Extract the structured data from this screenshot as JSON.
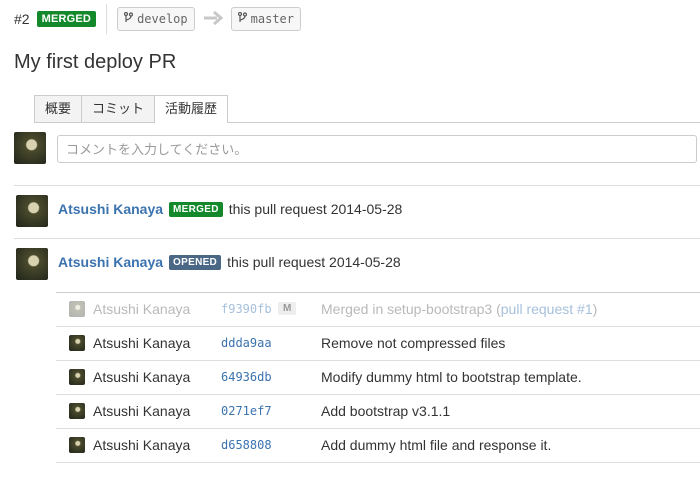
{
  "header": {
    "pr_number": "#2",
    "status": "MERGED",
    "source_branch": "develop",
    "target_branch": "master",
    "arrow_icon": "arrow-right-icon"
  },
  "title": "My first deploy PR",
  "tabs": [
    {
      "label": "概要",
      "active": false
    },
    {
      "label": "コミット",
      "active": false
    },
    {
      "label": "活動履歴",
      "active": true
    }
  ],
  "comment": {
    "placeholder": "コメントを入力してください。"
  },
  "events": [
    {
      "author": "Atsushi Kanaya",
      "status": "MERGED",
      "text": "this pull request 2014-05-28"
    },
    {
      "author": "Atsushi Kanaya",
      "status": "OPENED",
      "text": "this pull request 2014-05-28"
    }
  ],
  "commits": [
    {
      "author": "Atsushi Kanaya",
      "hash": "f9390fb",
      "tag": "M",
      "message": "Merged in setup-bootstrap3 (",
      "link": "pull request #1",
      "message_end": ")"
    },
    {
      "author": "Atsushi Kanaya",
      "hash": "ddda9aa",
      "message": "Remove not compressed files"
    },
    {
      "author": "Atsushi Kanaya",
      "hash": "64936db",
      "message": "Modify dummy html to bootstrap template."
    },
    {
      "author": "Atsushi Kanaya",
      "hash": "0271ef7",
      "message": "Add bootstrap v3.1.1"
    },
    {
      "author": "Atsushi Kanaya",
      "hash": "d658808",
      "message": "Add dummy html file and response it."
    }
  ],
  "colors": {
    "merged": "#14892c",
    "opened": "#4a6785",
    "link": "#3b73af"
  }
}
